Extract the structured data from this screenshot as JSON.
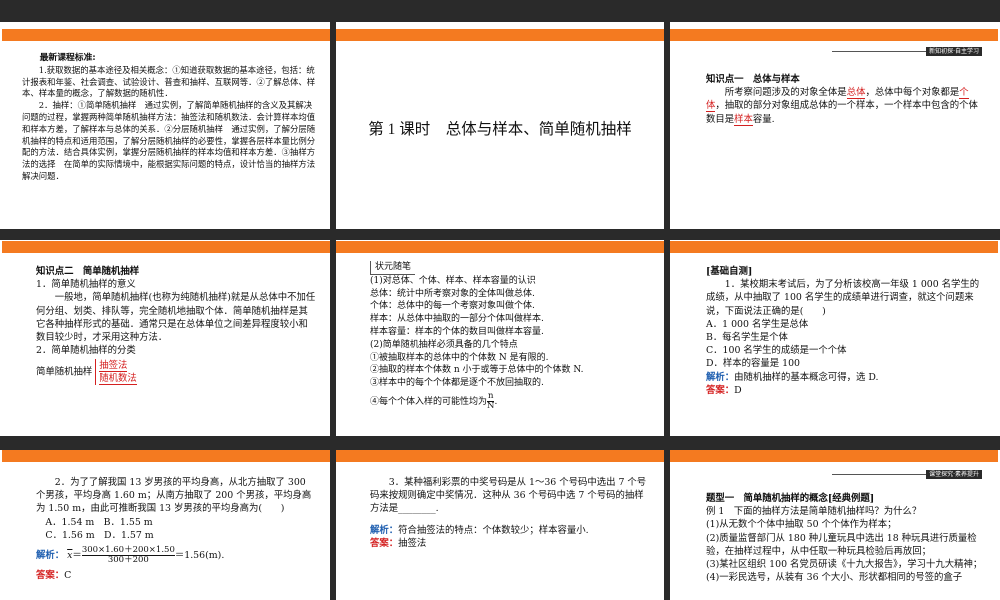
{
  "slide1": {
    "heading": "最新课程标准:",
    "p1": "1.获取数据的基本途径及相关概念：①知道获取数据的基本途径，包括：统计报表和年鉴、社会调查、试验设计、普查和抽样、互联网等．②了解总体、样本、样本量的概念，了解数据的随机性．",
    "p2": "2．抽样：①简单随机抽样　通过实例，了解简单随机抽样的含义及其解决问题的过程，掌握两种简单随机抽样方法：抽签法和随机数法．会计算样本均值和样本方差，了解样本与总体的关系．②分层随机抽样　通过实例，了解分层随机抽样的特点和适用范围，了解分层随机抽样的必要性，掌握各层样本量比例分配的方法．结合具体实例，掌握分层随机抽样的样本均值和样本方差．③抽样方法的选择　在简单的实际情境中，能根据实际问题的特点，设计恰当的抽样方法解决问题．"
  },
  "slide2": {
    "title": "第 1 课时　总体与样本、简单随机抽样"
  },
  "slide3": {
    "banner": "新知初探·自主学习",
    "heading": "知识点一　总体与样本",
    "t1": "所考察问题涉及的对象全体是",
    "w1": "总体",
    "t2": "，总体中每个对象都是",
    "w2": "个体",
    "t3": "，抽取的部分对象组成总体的一个样本，一个样本中包含的个体数目是",
    "w3": "样本",
    "t4": "容量."
  },
  "slide4": {
    "heading": "知识点二　简单随机抽样",
    "sub1": "1．简单随机抽样的意义",
    "p1": "一般地，简单随机抽样(也称为纯随机抽样)就是从总体中不加任何分组、划类、排队等，完全随机地抽取个体．简单随机抽样是其它各种抽样形式的基础．通常只是在总体单位之间差异程度较小和数目较少时，才采用这种方法．",
    "sub2": "2．简单随机抽样的分类",
    "cat_label": "简单随机抽样",
    "method1": "抽签法",
    "method2": "随机数法"
  },
  "slide5": {
    "note_title": "状元随笔",
    "l1": "(1)对总体、个体、样本、样本容量的认识",
    "l2": "总体：统计中所考察对象的全体叫做总体.",
    "l3": "个体：总体中的每一个考察对象叫做个体.",
    "l4": "样本：从总体中抽取的一部分个体叫做样本.",
    "l5": "样本容量：样本的个体的数目叫做样本容量.",
    "l6": "(2)简单随机抽样必须具备的几个特点",
    "l7": "①被抽取样本的总体中的个体数 N 是有限的.",
    "l8": "②抽取的样本个体数 n 小于或等于总体中的个体数 N.",
    "l9": "③样本中的每个个体都是逐个不放回抽取的.",
    "l10": "④每个个体入样的可能性均为",
    "frac_num": "n",
    "frac_den": "N",
    "l10_end": "."
  },
  "slide6": {
    "heading": "[基础自测]",
    "q": "1．某校期末考试后，为了分析该校高一年级 1 000 名学生的成绩，从中抽取了 100 名学生的成绩单进行调查，就这个问题来说，下面说法正确的是(　　)",
    "oA": "A．1 000 名学生是总体",
    "oB": "B．每名学生是个体",
    "oC": "C．100 名学生的成绩是一个个体",
    "oD": "D．样本的容量是 100",
    "jx_label": "解析：",
    "jx": "由随机抽样的基本概念可得，选 D.",
    "da_label": "答案：",
    "da": "D"
  },
  "slide7": {
    "q": "2．为了了解我国 13 岁男孩的平均身高，从北方抽取了 300 个男孩，平均身高 1.60 m；从南方抽取了 200 个男孩，平均身高为 1.50 m，由此可推断我国 13 岁男孩的平均身高为(　　)",
    "oAB": "A．1.54 m　B．1.55 m",
    "oCD": "C．1.56 m　D．1.57 m",
    "jx_label": "解析：",
    "xbar": "x",
    "frac_num": "300×1.60＋200×1.50",
    "frac_den": "300＋200",
    "result": "＝1.56(m).",
    "da_label": "答案：",
    "da": "C"
  },
  "slide8": {
    "q": "3．某种福利彩票的中奖号码是从 1～36 个号码中选出 7 个号码来按规则确定中奖情况．这种从 36 个号码中选 7 个号码的抽样方法是________.",
    "jx_label": "解析：",
    "jx": "符合抽签法的特点：个体数较少；样本容量小.",
    "da_label": "答案：",
    "da": "抽签法"
  },
  "slide9": {
    "banner": "课堂探究·素养提升",
    "heading": "题型一　简单随机抽样的概念[经典例题]",
    "q": "例 1　下面的抽样方法是简单随机抽样吗？为什么？",
    "i1": "(1)从无数个个体中抽取 50 个个体作为样本；",
    "i2": "(2)质量监督部门从 180 种儿童玩具中选出 18 种玩具进行质量检验，在抽样过程中，从中任取一种玩具检验后再放回；",
    "i3": "(3)某社区组织 100 名党员研读《十九大报告》，学习十九大精神；",
    "i4": "(4)一彩民选号，从装有 36 个大小、形状都相同的号签的盒子"
  }
}
